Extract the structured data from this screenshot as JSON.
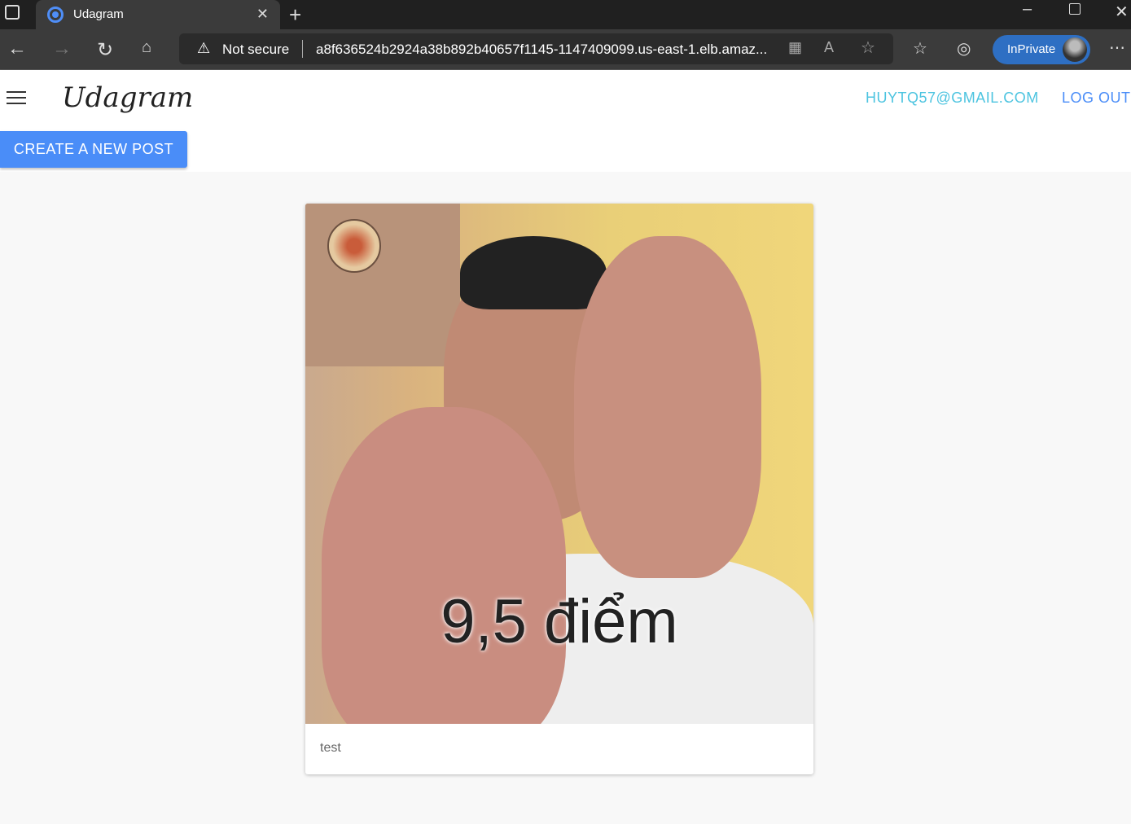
{
  "browser": {
    "tab_title": "Udagram",
    "not_secure": "Not secure",
    "url": "a8f636524b2924a38b892b40657f1145-1147409099.us-east-1.elb.amaz...",
    "inprivate": "InPrivate"
  },
  "header": {
    "logo": "Udagram",
    "email": "HUYTQ57@GMAIL.COM",
    "logout": "LOG OUT"
  },
  "actions": {
    "create": "CREATE A NEW POST"
  },
  "feed": [
    {
      "image_text": "9,5 điểm",
      "caption": "test"
    }
  ]
}
